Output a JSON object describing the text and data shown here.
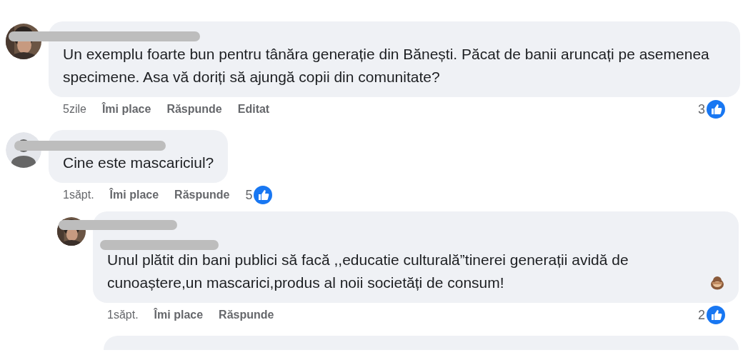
{
  "comments": [
    {
      "kind": "comment",
      "text": "Un exemplu foarte bun pentru tânăra generație din Bănești. Păcat de banii aruncați pe asemenea specimene. Asa vă doriți să ajungă copii din comunitate?",
      "time": "5zile",
      "like": "Îmi place",
      "reply": "Răspunde",
      "edited": "Editat",
      "reactions": "3"
    },
    {
      "kind": "comment",
      "avatar": {
        "kind": "default"
      },
      "text": "Cine este mascariciul?",
      "time": "1săpt.",
      "like": "Îmi place",
      "reply": "Răspunde",
      "reactions": "5",
      "replies": [
        {
          "kind": "reply",
          "text": "Unul plătit din bani publici să facă ,,educatie culturală”tinerei generații avidă de cunoaștere,un mascarici,produs al noii societăți de consum!",
          "trailing_emoji": true,
          "time": "1săpt.",
          "like": "Îmi place",
          "reply": "Răspunde",
          "reactions": "2"
        }
      ]
    }
  ],
  "more_below": true
}
